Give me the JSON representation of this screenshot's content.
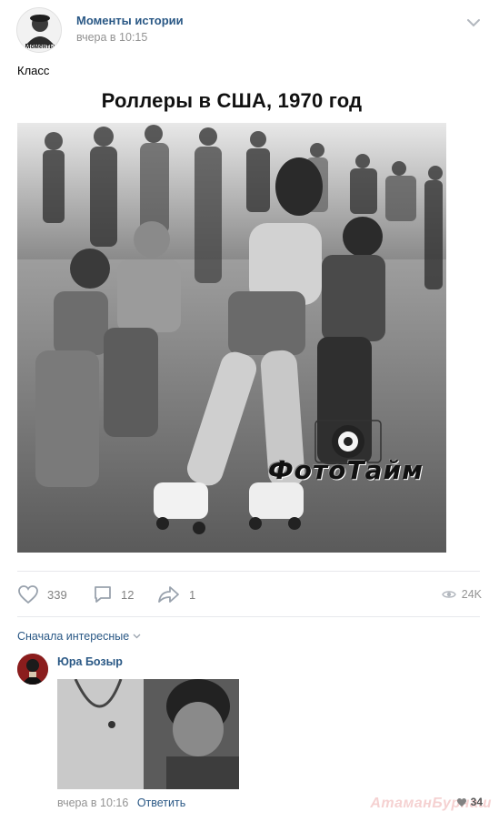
{
  "post": {
    "group_name": "Моменты истории",
    "avatar_text": "Моменты",
    "time": "вчера в 10:15",
    "text": "Класс",
    "image_caption": "Роллеры в США, 1970 год",
    "image_watermark": "ФотоТайм"
  },
  "actions": {
    "likes": "339",
    "comments": "12",
    "shares": "1",
    "views": "24K"
  },
  "comments_section": {
    "sort_label": "Сначала интересные",
    "items": [
      {
        "author": "Юра Бозыр",
        "time": "вчера в 10:16",
        "reply_label": "Ответить",
        "likes": "34"
      }
    ]
  },
  "site_watermark": "АтаманБурнаш",
  "colors": {
    "link": "#2a5885",
    "muted": "#939393",
    "divider": "#e7e8ec"
  }
}
